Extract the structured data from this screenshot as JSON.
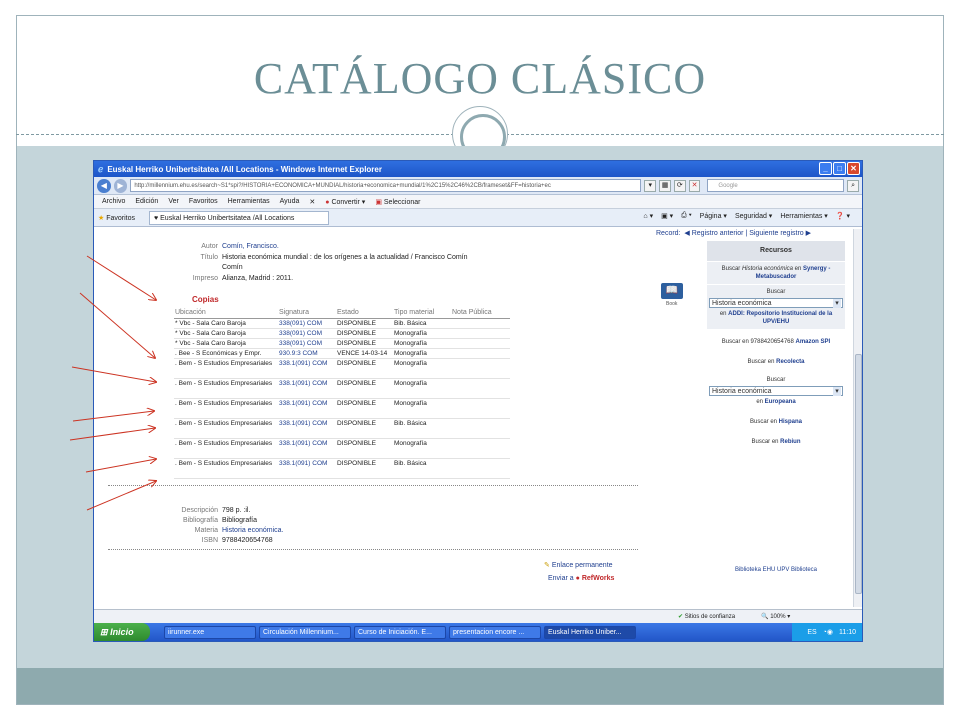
{
  "slide": {
    "title": "CATÁLOGO CLÁSICO",
    "colors": {
      "title": "#6b8e96",
      "band": "#c4d5da",
      "footer": "#8eaaae",
      "arrow": "#cc3322"
    }
  },
  "window": {
    "title": "Euskal Herriko Unibertsitatea /All Locations - Windows Internet Explorer",
    "url": "http://millennium.ehu.es/search~S1*spi?/HISTORIA+ECONOMICA+MUNDIAL/historia+economica+mundial/1%2C15%2C46%2CB/frameset&FF=historia+ec",
    "search_placeholder": "Google",
    "menu": [
      "Archivo",
      "Edición",
      "Ver",
      "Favoritos",
      "Herramientas",
      "Ayuda"
    ],
    "menu_tools": [
      "Convertir",
      "Seleccionar"
    ],
    "favorites_label": "Favoritos",
    "tab_label": "Euskal Herriko Unibertsitatea /All Locations",
    "command_bar": [
      "Página",
      "Seguridad",
      "Herramientas"
    ]
  },
  "record": {
    "nav": {
      "prev": "Registro anterior",
      "next": "Siguiente registro",
      "record_partial": "Record:"
    },
    "autor": {
      "label": "Autor",
      "value": "Comín, Francisco."
    },
    "titulo": {
      "label": "Título",
      "value": "Historia económica mundial : de los orígenes a la actualidad / Francisco Comín",
      "value2": "Comín"
    },
    "impreso": {
      "label": "Impreso",
      "value": "Alianza, Madrid : 2011."
    },
    "copias_title": "Copias",
    "columns": [
      "Ubicación",
      "Signatura",
      "Estado",
      "Tipo material",
      "Nota Pública"
    ],
    "copies": [
      {
        "ubicacion": "* Vbc - Sala Caro Baroja",
        "signatura": "338(091) COM",
        "estado": "DISPONIBLE",
        "tipo": "Bib. Básica"
      },
      {
        "ubicacion": "* Vbc - Sala Caro Baroja",
        "signatura": "338(091) COM",
        "estado": "DISPONIBLE",
        "tipo": "Monografía"
      },
      {
        "ubicacion": "* Vbc - Sala Caro Baroja",
        "signatura": "338(091) COM",
        "estado": "DISPONIBLE",
        "tipo": "Monografía"
      },
      {
        "ubicacion": ". Bee - S Económicas y Empr.",
        "signatura": "930.9:3 COM",
        "estado": "VENCE 14-03-14",
        "tipo": "Monografía"
      },
      {
        "ubicacion": ". Bem - S Estudios Empresariales",
        "signatura": "338.1(091) COM",
        "estado": "DISPONIBLE",
        "tipo": "Monografía"
      },
      {
        "ubicacion": ". Bem - S Estudios Empresariales",
        "signatura": "338.1(091) COM",
        "estado": "DISPONIBLE",
        "tipo": "Monografía"
      },
      {
        "ubicacion": ". Bem - S Estudios Empresariales",
        "signatura": "338.1(091) COM",
        "estado": "DISPONIBLE",
        "tipo": "Monografía"
      },
      {
        "ubicacion": ". Bem - S Estudios Empresariales",
        "signatura": "338.1(091) COM",
        "estado": "DISPONIBLE",
        "tipo": "Bib. Básica"
      },
      {
        "ubicacion": ". Bem - S Estudios Empresariales",
        "signatura": "338.1(091) COM",
        "estado": "DISPONIBLE",
        "tipo": "Monografía"
      },
      {
        "ubicacion": ". Bem - S Estudios Empresariales",
        "signatura": "338.1(091) COM",
        "estado": "DISPONIBLE",
        "tipo": "Bib. Básica"
      }
    ],
    "descripcion": {
      "label": "Descripción",
      "value": "798 p. :il."
    },
    "bibliografia": {
      "label": "Bibliografía",
      "value": "Bibliografía"
    },
    "materia": {
      "label": "Materia",
      "value": "Historia económica."
    },
    "isbn": {
      "label": "ISBN",
      "value": "9788420654768"
    },
    "enlace": "Enlace permanente",
    "enviar": "Enviar a",
    "refworks": "RefWorks",
    "book_label": "Book"
  },
  "recursos": {
    "title": "Recursos",
    "buscar_prefix": "Buscar",
    "buscar_term": "Historia económica",
    "synergy": "Synergy - Metabuscador",
    "en": "en",
    "buscar": "Buscar",
    "select_value": "Historia económica",
    "addi": "ADDI: Repositorio Institucional de la UPV/EHU",
    "amazon_prefix": "Buscar en 9788420654768",
    "amazon": "Amazon SPI",
    "recolecta_prefix": "Buscar en",
    "recolecta": "Recolecta",
    "europeana": "Europeana",
    "hispana": "Hispana",
    "rebiun": "Rebiun",
    "bottom_partial": "Biblioteka EHU UPV Biblioteca"
  },
  "status": {
    "zone": "Sitios de confianza",
    "zoom": "100%"
  },
  "taskbar": {
    "start": "Inicio",
    "items": [
      "iirunner.exe",
      "Circulación Millennium...",
      "Curso de Iniciación. E...",
      "presentacion encore ...",
      "Euskal Herriko Uniber..."
    ],
    "lang": "ES",
    "time": "11:10"
  }
}
